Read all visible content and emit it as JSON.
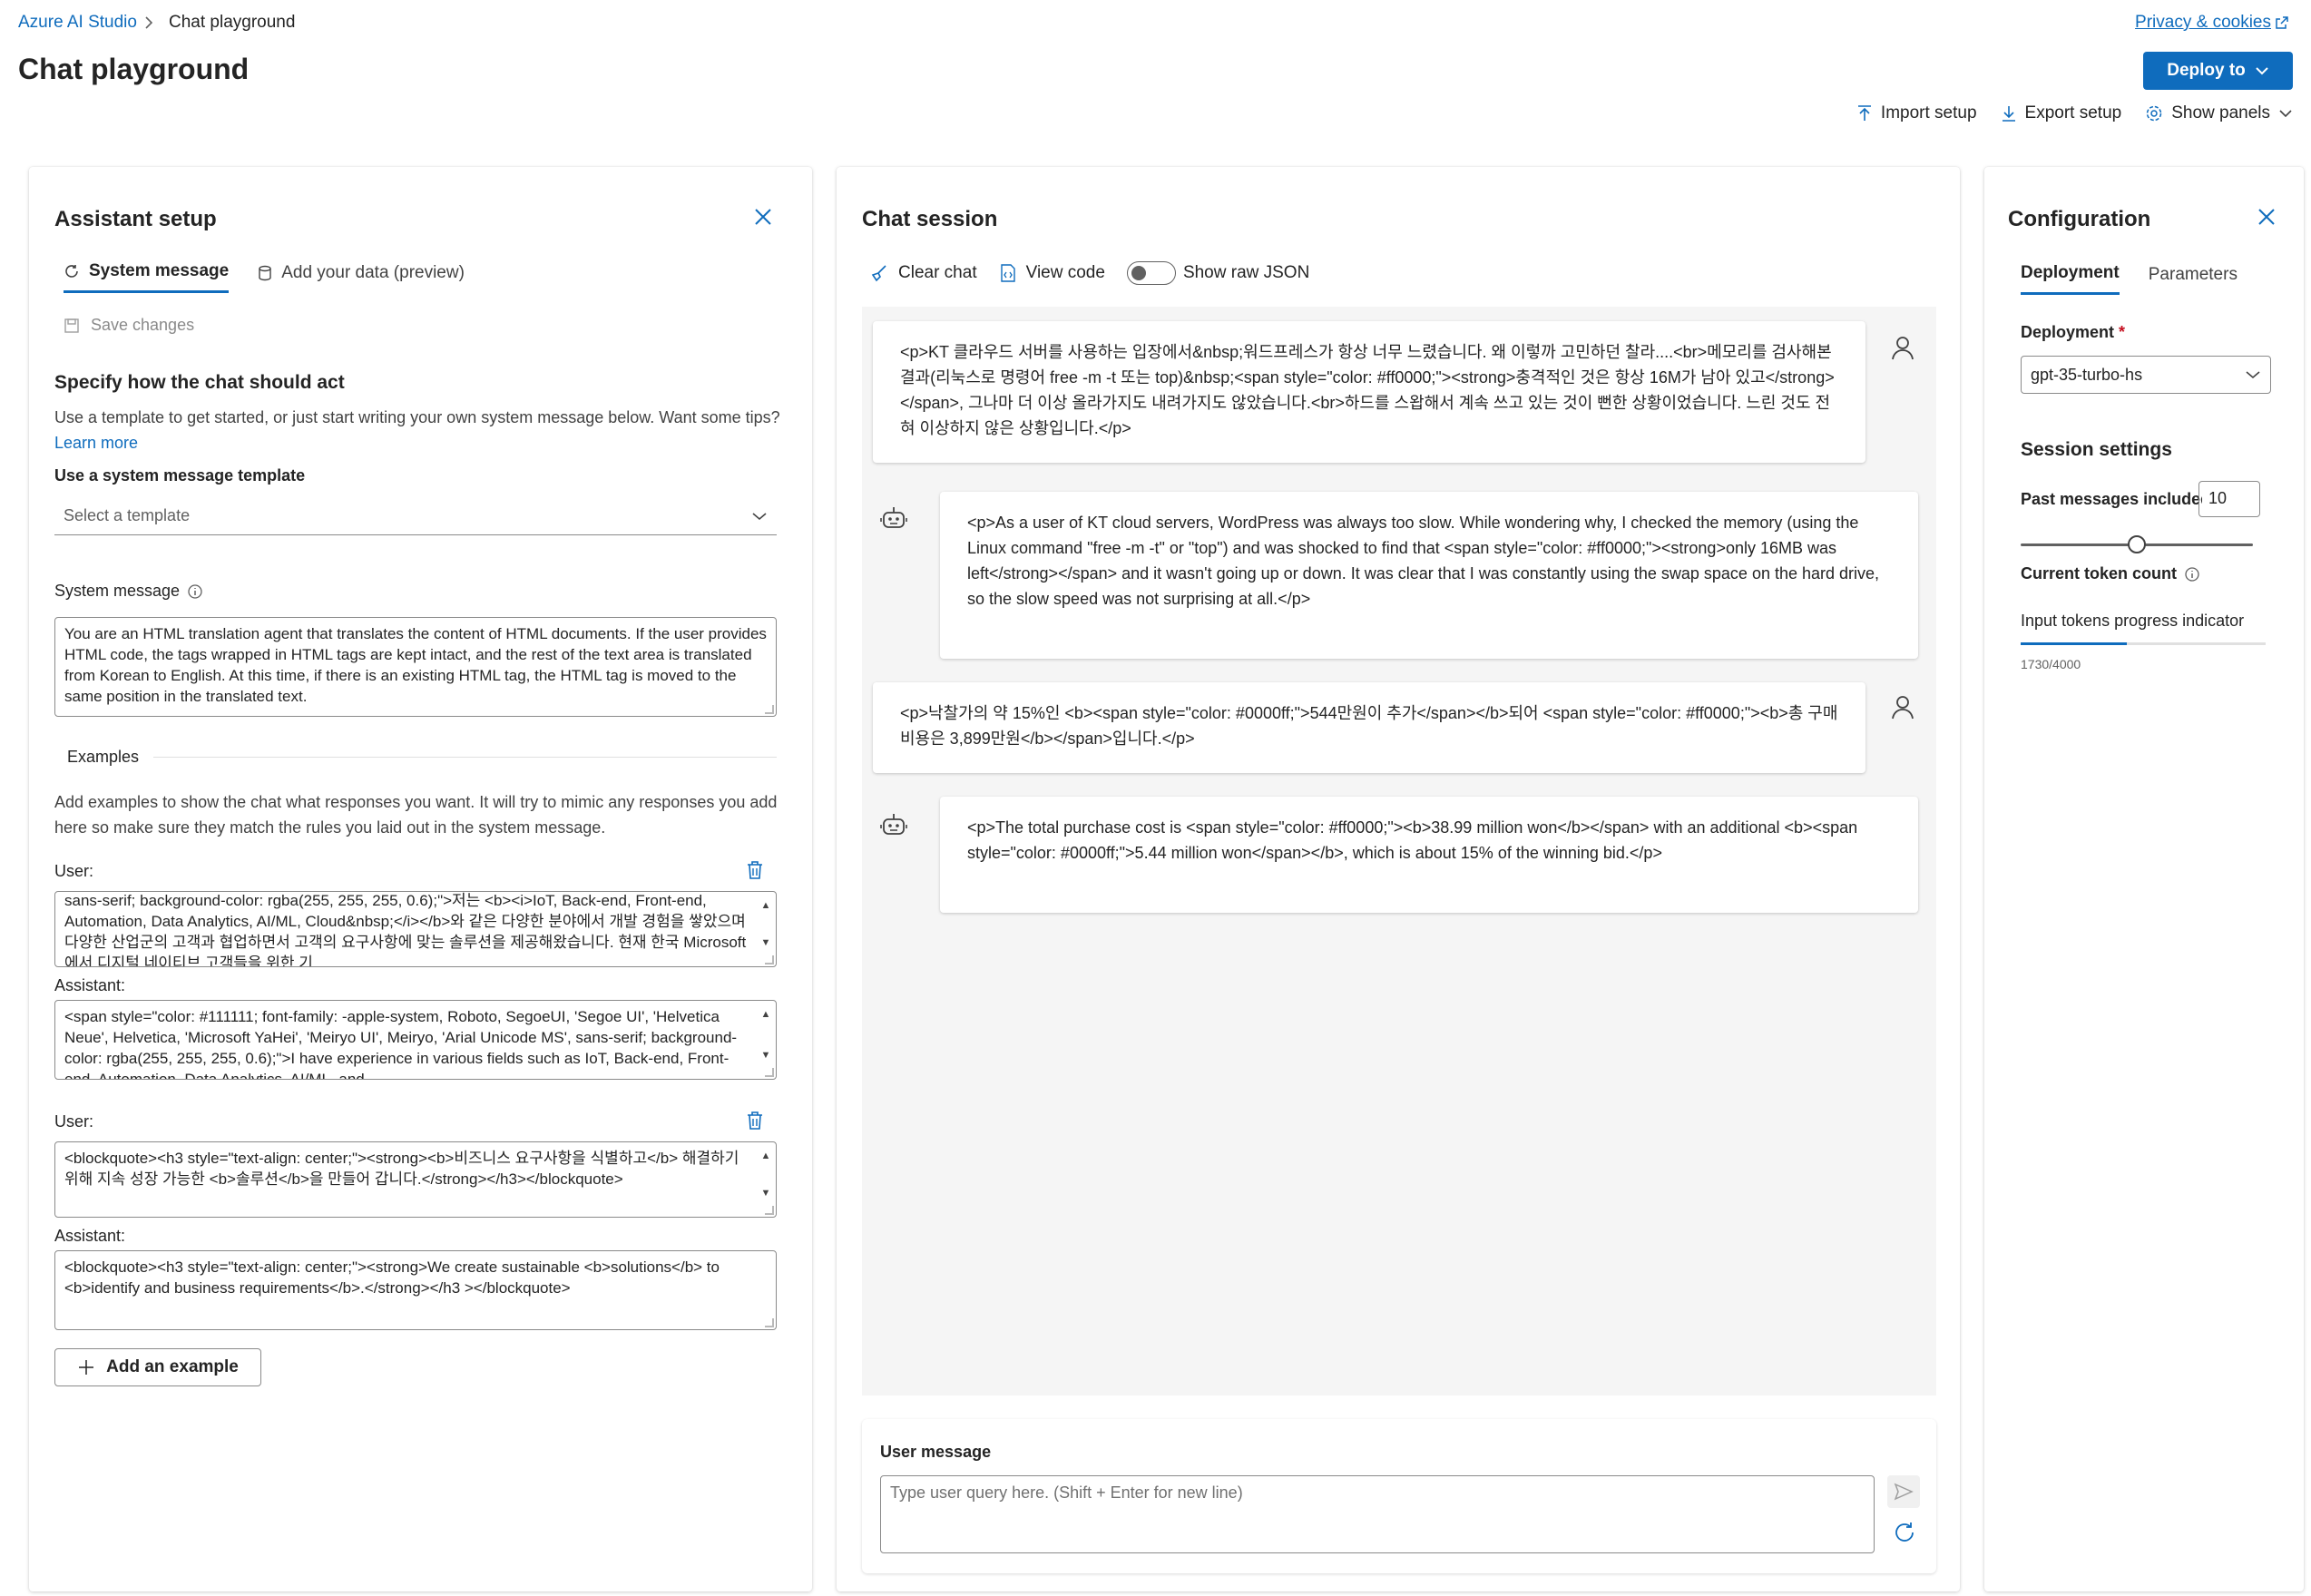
{
  "breadcrumb": {
    "root": "Azure AI Studio",
    "current": "Chat playground"
  },
  "header": {
    "title": "Chat playground",
    "privacy_link": "Privacy & cookies",
    "deploy_label": "Deploy to",
    "toolbar": {
      "import": "Import setup",
      "export": "Export setup",
      "show_panels": "Show panels"
    }
  },
  "assistant_setup": {
    "title": "Assistant setup",
    "tabs": {
      "system_message": "System message",
      "add_data": "Add your data (preview)"
    },
    "save_changes": "Save changes",
    "specify_heading": "Specify how the chat should act",
    "specify_desc": "Use a template to get started, or just start writing your own system message below. Want some tips?",
    "learn_more": "Learn more",
    "template_label": "Use a system message template",
    "template_placeholder": "Select a template",
    "system_message_label": "System message",
    "system_message_text": "You are an HTML translation agent that translates the content of HTML documents. If the user provides HTML code, the tags wrapped in HTML tags are kept intact, and the rest of the text area is translated from Korean to English. At this time, if there is an existing HTML tag, the HTML tag is moved to the same position in the translated text.",
    "examples_label": "Examples",
    "examples_desc": "Add examples to show the chat what responses you want. It will try to mimic any responses you add here so make sure they match the rules you laid out in the system message.",
    "examples": [
      {
        "user_label": "User:",
        "user_text": "sans-serif; background-color: rgba(255, 255, 255, 0.6);\">저는 <b><i>IoT, Back-end, Front-end, Automation, Data Analytics, AI/ML, Cloud&nbsp;</i></b>와 같은 다양한 분야에서 개발 경험을 쌓았으며 다양한 산업군의 고객과 협업하면서 고객의 요구사항에 맞는 솔루션을 제공해왔습니다. 현재 한국 Microsoft에서 디지털 네이티브 고객들을 위한 기",
        "assistant_label": "Assistant:",
        "assistant_text": "<span style=\"color: #111111; font-family: -apple-system, Roboto, SegoeUI, 'Segoe UI', 'Helvetica Neue', Helvetica, 'Microsoft YaHei', 'Meiryo UI', Meiryo, 'Arial Unicode MS', sans-serif; background-color: rgba(255, 255, 255, 0.6);\">I have experience in various fields such as IoT, Back-end, Front-end, Automation, Data Analytics, AI/ML, and"
      },
      {
        "user_label": "User:",
        "user_text": "<blockquote><h3 style=\"text-align: center;\"><strong><b>비즈니스 요구사항을 식별하고</b> 해결하기 위해 지속 성장 가능한 <b>솔루션</b>을 만들어 갑니다.</strong></h3></blockquote>",
        "assistant_label": "Assistant:",
        "assistant_text": "<blockquote><h3 style=\"text-align: center;\"><strong>We create sustainable <b>solutions</b> to <b>identify and business requirements</b>.</strong></h3 ></blockquote>"
      }
    ],
    "add_example": "Add an example"
  },
  "chat_session": {
    "title": "Chat session",
    "clear_chat": "Clear chat",
    "view_code": "View code",
    "show_raw_json": "Show raw JSON",
    "messages": [
      {
        "role": "user",
        "text": "<p>KT 클라우드 서버를 사용하는 입장에서&nbsp;워드프레스가 항상 너무 느렸습니다. 왜 이렇까 고민하던 찰라....<br>메모리를 검사해본 결과(리눅스로 명령어 free -m -t 또는 top)&nbsp;<span style=\"color: #ff0000;\"><strong>충격적인 것은 항상 16M가 남아 있고</strong></span>, 그나마 더 이상 올라가지도 내려가지도 않았습니다.<br>하드를 스왑해서 계속 쓰고 있는 것이 뻔한 상황이었습니다. 느린 것도 전혀 이상하지 않은 상황입니다.</p>"
      },
      {
        "role": "assistant",
        "text": "<p>As a user of KT cloud servers, WordPress was always too slow. While wondering why, I checked the memory (using the Linux command \"free -m -t\" or \"top\") and was shocked to find that <span style=\"color: #ff0000;\"><strong>only 16MB was left</strong></span> and it wasn't going up or down. It was clear that I was constantly using the swap space on the hard drive, so the slow speed was not surprising at all.</p>"
      },
      {
        "role": "user",
        "text": "<p>낙찰가의 약 15%인 <b><span style=\"color: #0000ff;\">544만원이 추가</span></b>되어 <span style=\"color: #ff0000;\"><b>총 구매비용은 3,899만원</b></span>입니다.</p>"
      },
      {
        "role": "assistant",
        "text": "<p>The total purchase cost is <span style=\"color: #ff0000;\"><b>38.99 million won</b></span> with an additional <b><span style=\"color: #0000ff;\">5.44 million won</span></b>, which is about 15% of the winning bid.</p>"
      }
    ],
    "user_message_label": "User message",
    "user_message_placeholder": "Type user query here. (Shift + Enter for new line)"
  },
  "configuration": {
    "title": "Configuration",
    "tabs": {
      "deployment": "Deployment",
      "parameters": "Parameters"
    },
    "deployment_label": "Deployment",
    "required_mark": "*",
    "deployment_value": "gpt-35-turbo-hs",
    "session_settings": "Session settings",
    "past_messages_label": "Past messages included",
    "past_messages_value": "10",
    "past_messages_slider_fraction": 0.5,
    "current_token_count": "Current token count",
    "input_tokens_label": "Input tokens progress indicator",
    "token_progress_fraction": 0.4325,
    "token_count": "1730/4000"
  },
  "colors": {
    "accent": "#0f6cbd",
    "text": "#242424",
    "chat_bg": "#f5f5f5"
  }
}
